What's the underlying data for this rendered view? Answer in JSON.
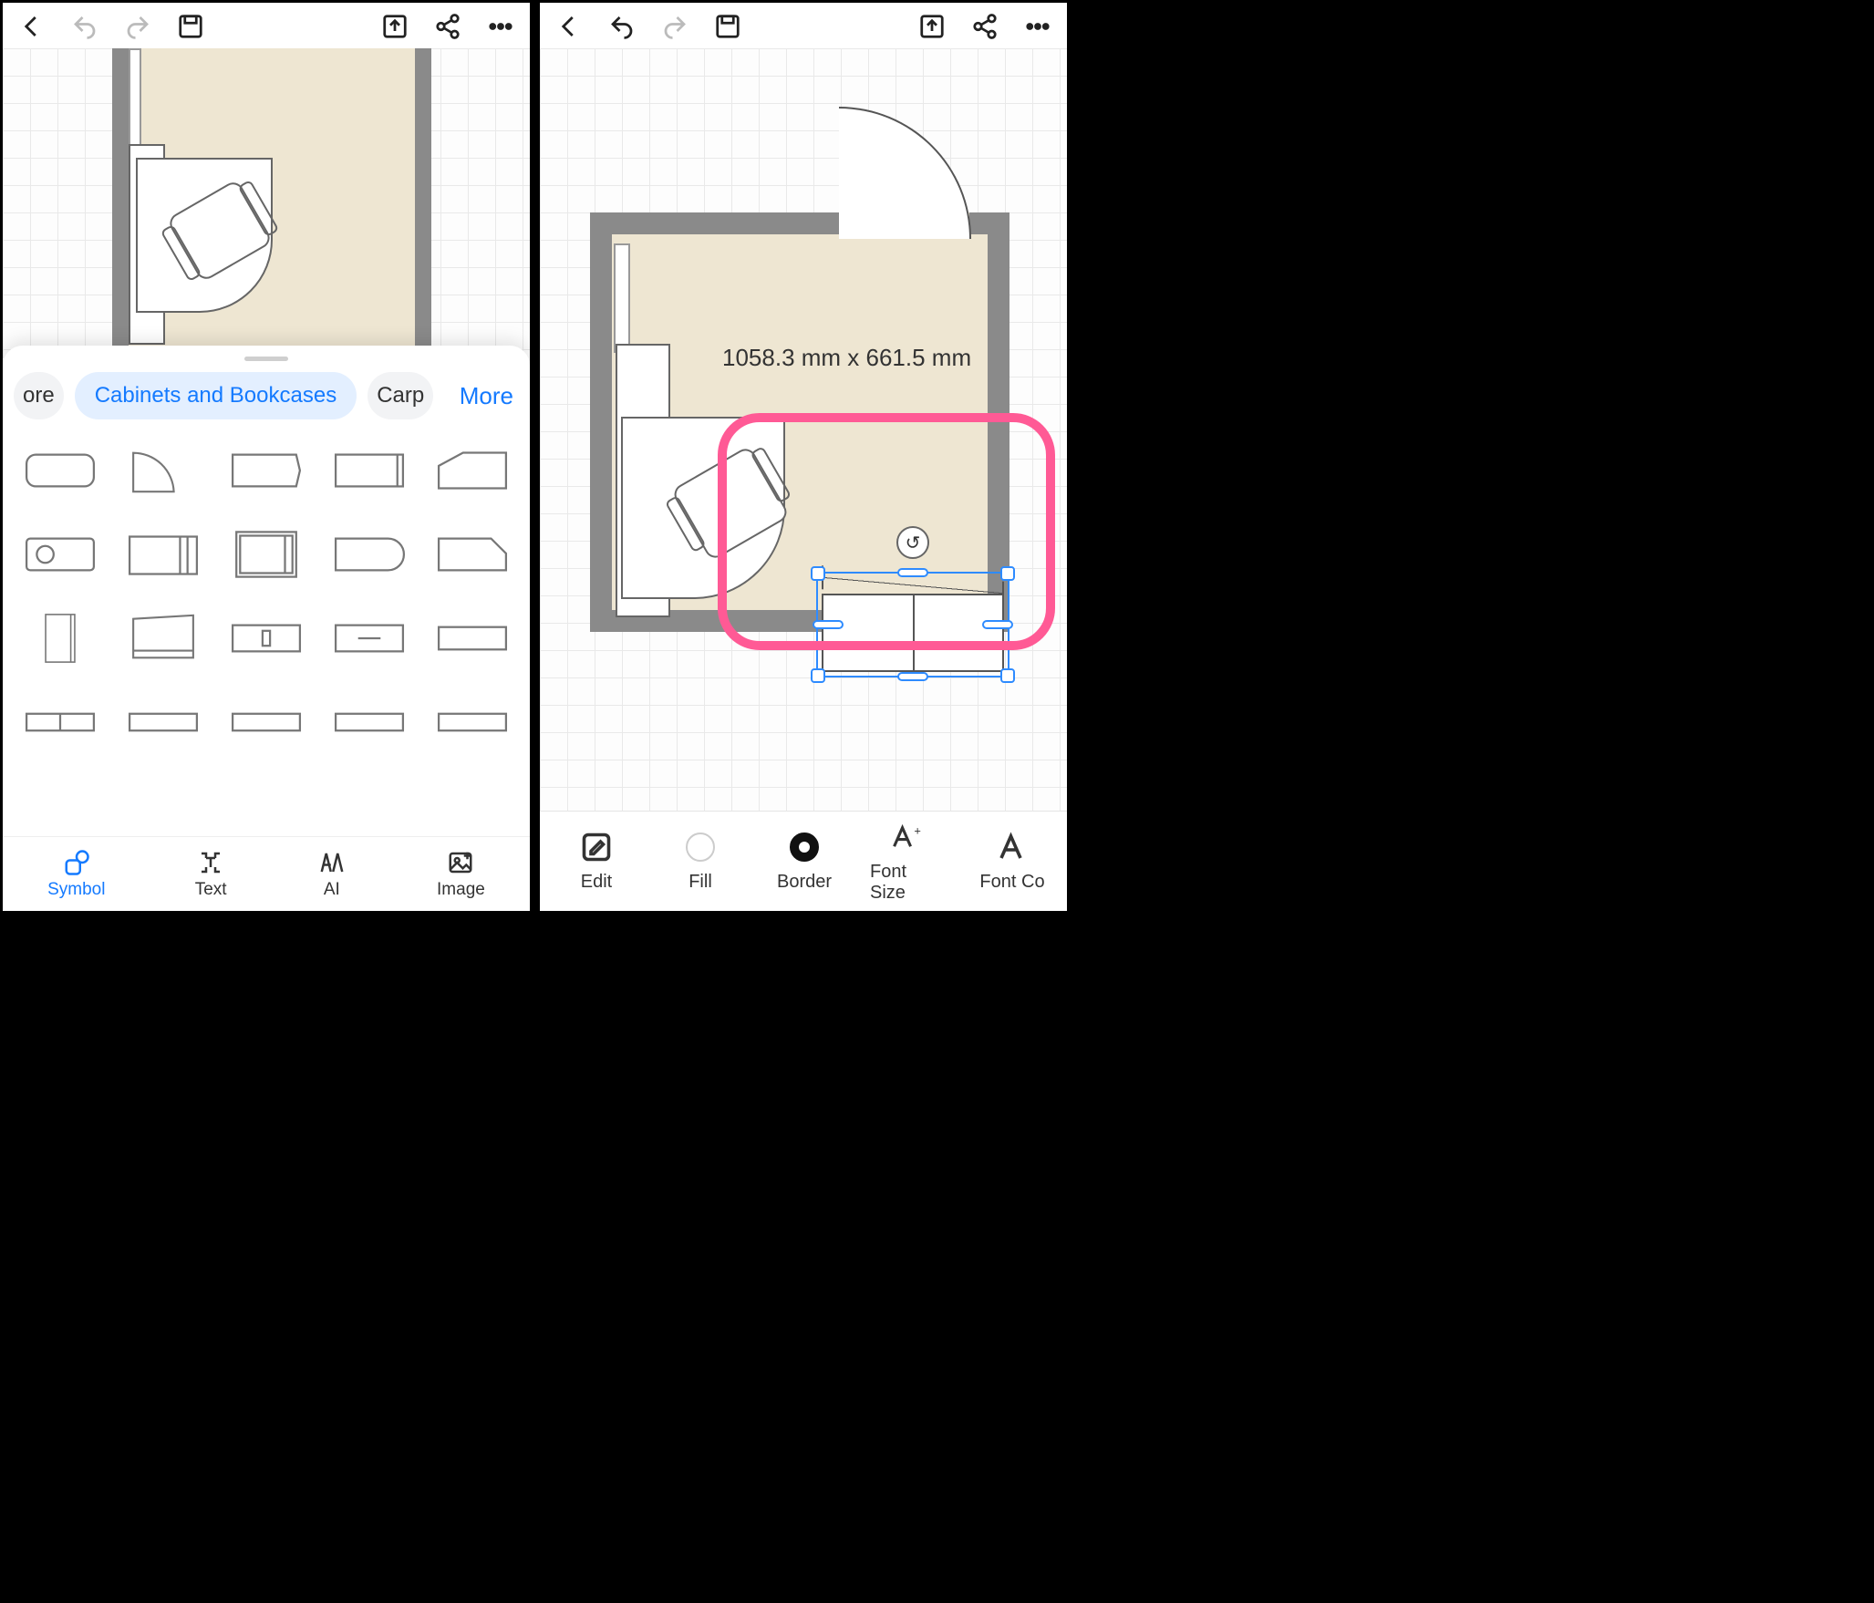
{
  "left": {
    "chips": {
      "prev_partial": "ore",
      "active": "Cabinets and Bookcases",
      "next_partial": "Carp",
      "more": "More"
    },
    "tabs": {
      "symbol": "Symbol",
      "text": "Text",
      "ai": "AI",
      "image": "Image"
    }
  },
  "right": {
    "dimension": "1058.3 mm x 661.5 mm",
    "edit": {
      "edit": "Edit",
      "fill": "Fill",
      "border": "Border",
      "font_size": "Font Size",
      "font_color_partial": "Font Co"
    }
  }
}
